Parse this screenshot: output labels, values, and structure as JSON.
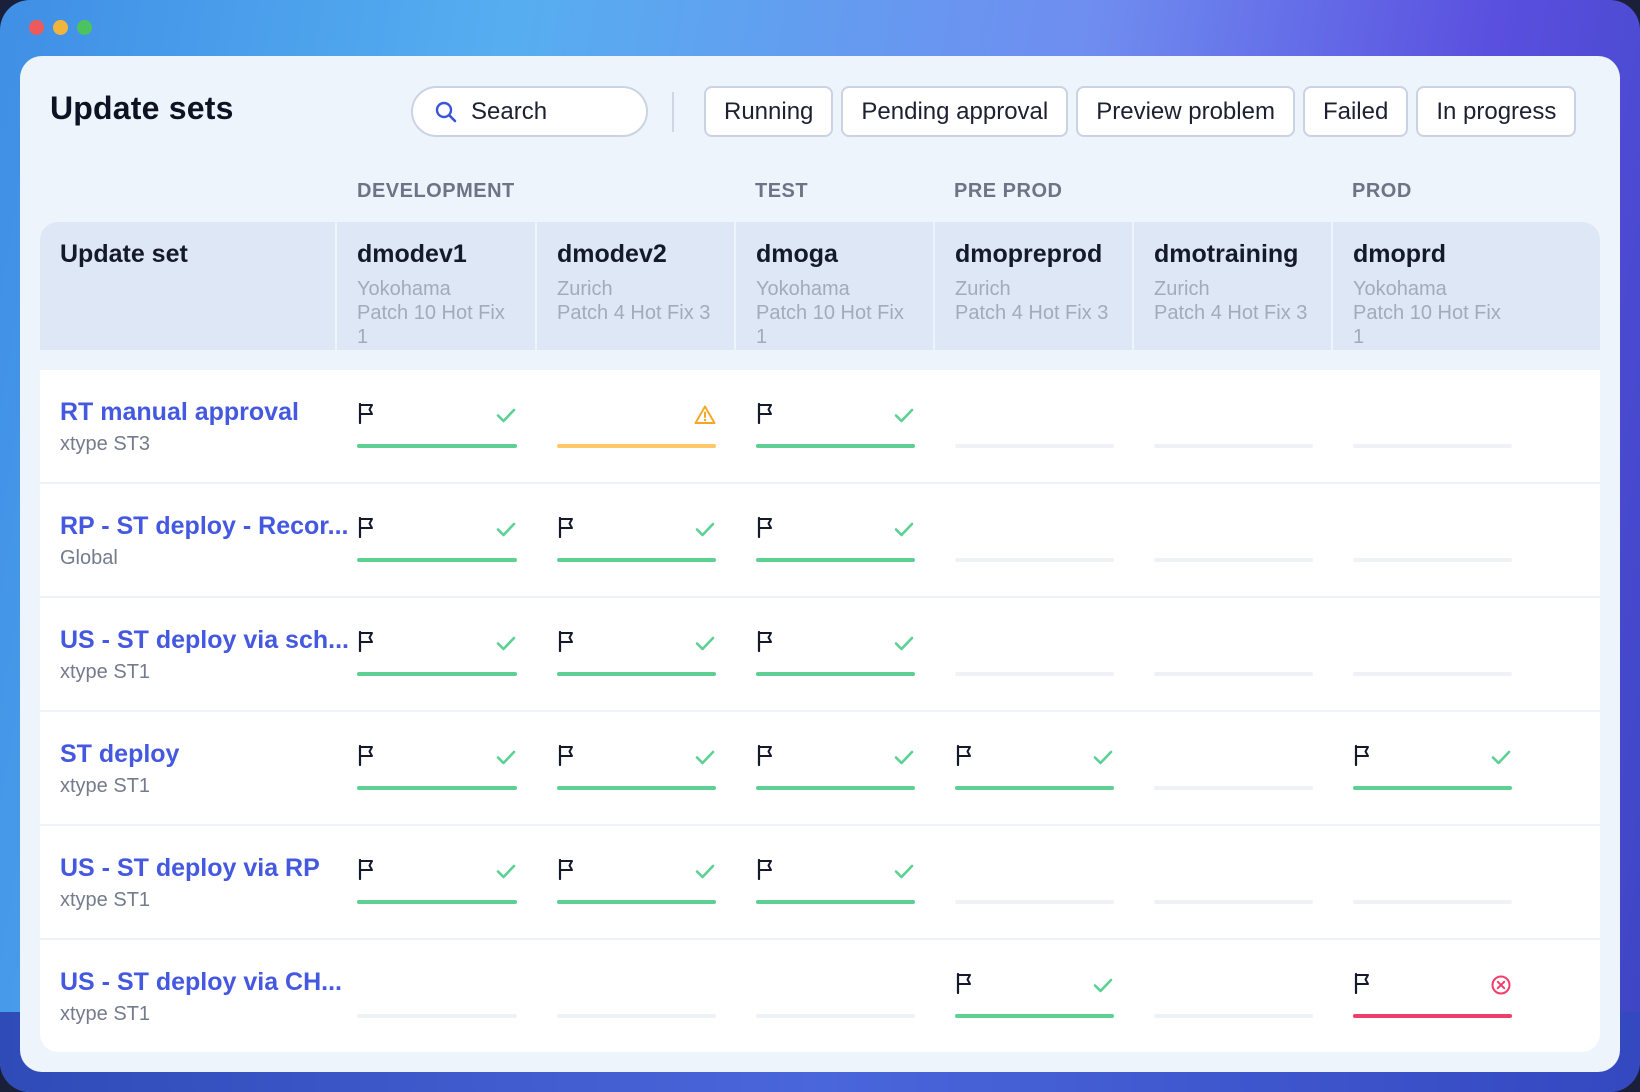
{
  "window_controls": [
    "close",
    "minimize",
    "maximize"
  ],
  "header": {
    "title": "Update sets",
    "search_placeholder": "Search",
    "filters": [
      "Running",
      "Pending approval",
      "Preview problem",
      "Failed",
      "In progress"
    ]
  },
  "environments": [
    {
      "label": "DEVELOPMENT",
      "column": 1
    },
    {
      "label": "TEST",
      "column": 3
    },
    {
      "label": "PRE PROD",
      "column": 4
    },
    {
      "label": "PROD",
      "column": 6
    }
  ],
  "table": {
    "first_column_header": "Update set",
    "instances": [
      {
        "name": "dmodev1",
        "location": "Yokohama",
        "version": "Patch 10 Hot Fix 1"
      },
      {
        "name": "dmodev2",
        "location": "Zurich",
        "version": "Patch 4 Hot Fix 3"
      },
      {
        "name": "dmoga",
        "location": "Yokohama",
        "version": "Patch 10 Hot Fix 1"
      },
      {
        "name": "dmopreprod",
        "location": "Zurich",
        "version": "Patch 4 Hot Fix 3"
      },
      {
        "name": "dmotraining",
        "location": "Zurich",
        "version": "Patch 4 Hot Fix 3"
      },
      {
        "name": "dmoprd",
        "location": "Yokohama",
        "version": "Patch 10 Hot Fix 1"
      }
    ],
    "rows": [
      {
        "name": "RT manual approval",
        "scope": "xtype ST3",
        "statuses": [
          "success",
          "warning",
          "success",
          "none",
          "none",
          "none"
        ]
      },
      {
        "name": "RP - ST deploy - Recor...",
        "scope": "Global",
        "statuses": [
          "success",
          "success",
          "success",
          "none",
          "none",
          "none"
        ]
      },
      {
        "name": "US - ST deploy via sch...",
        "scope": "xtype ST1",
        "statuses": [
          "success",
          "success",
          "success",
          "none",
          "none",
          "none"
        ]
      },
      {
        "name": "ST deploy",
        "scope": "xtype ST1",
        "statuses": [
          "success",
          "success",
          "success",
          "success",
          "none",
          "success"
        ]
      },
      {
        "name": "US - ST deploy via RP",
        "scope": "xtype ST1",
        "statuses": [
          "success",
          "success",
          "success",
          "none",
          "none",
          "none"
        ]
      },
      {
        "name": "US - ST deploy via CH...",
        "scope": "xtype ST1",
        "statuses": [
          "none",
          "none",
          "none",
          "success",
          "none",
          "failed"
        ]
      }
    ]
  },
  "colors": {
    "link": "#4458e0",
    "success": "#5cd193",
    "warning": "#ffc867",
    "failed": "#ef3e6a",
    "empty": "#eef2f7"
  },
  "icons": {
    "search": "search-icon",
    "flag": "flag-icon",
    "success": "check-icon",
    "warning": "warning-icon",
    "failed": "error-circle-icon"
  }
}
